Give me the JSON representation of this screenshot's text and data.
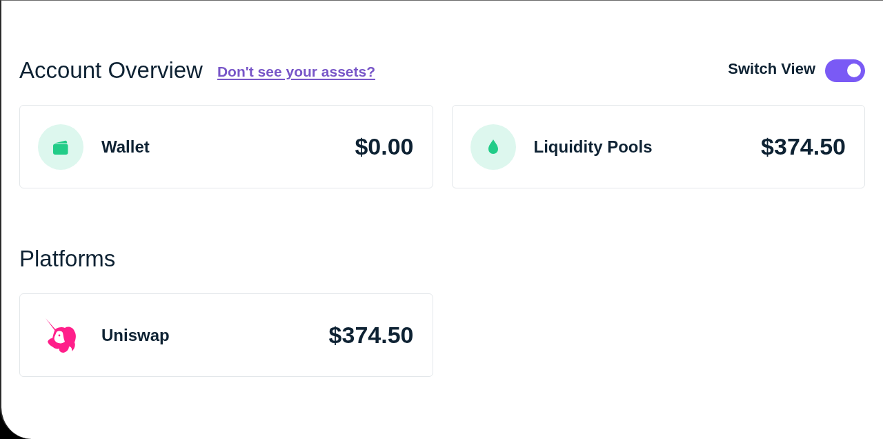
{
  "overview": {
    "title": "Account Overview",
    "help_link": "Don't see your assets?",
    "switch_view": {
      "label": "Switch View",
      "on": true
    },
    "cards": [
      {
        "kind": "wallet",
        "label": "Wallet",
        "value": "$0.00"
      },
      {
        "kind": "pool",
        "label": "Liquidity Pools",
        "value": "$374.50"
      }
    ]
  },
  "platforms": {
    "title": "Platforms",
    "items": [
      {
        "kind": "unicorn",
        "label": "Uniswap",
        "value": "$374.50"
      }
    ]
  }
}
